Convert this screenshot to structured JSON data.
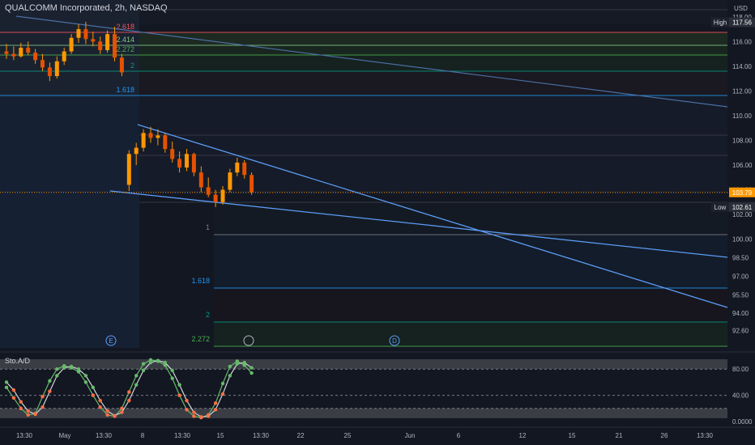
{
  "header": {
    "title": "QUALCOMM Incorporated, 2h, NASDAQ"
  },
  "axis": {
    "currency": "USD",
    "high_label": "High",
    "low_label": "Low"
  },
  "colors": {
    "background": "#131722",
    "up": "#ff9800",
    "down": "#ff9800",
    "trend": "#5b9cf6",
    "grid": "#2a2e39",
    "stoch_k": "#66bb6a",
    "stoch_d": "#ff7043"
  },
  "chart_data": [
    {
      "type": "candlestick",
      "title": "QUALCOMM Incorporated, 2h, NASDAQ",
      "y_ticks": [
        "118.00",
        "116.00",
        "114.00",
        "112.00",
        "110.00",
        "108.00",
        "106.00",
        "104.00",
        "102.00",
        "100.00",
        "98.50",
        "97.00",
        "95.50",
        "94.00",
        "92.60"
      ],
      "y_tick_values": [
        118,
        116,
        114,
        112,
        110,
        108,
        106,
        104,
        102,
        100,
        98.5,
        97,
        95.5,
        94,
        92.6
      ],
      "ylim": [
        91.2,
        119.1
      ],
      "x_ticks": [
        "13:30",
        "May",
        "13:30",
        "8",
        "13:30",
        "15",
        "13:30",
        "22",
        "25",
        "Jun",
        "6",
        "12",
        "15",
        "21",
        "26",
        "13:30"
      ],
      "price_labels": {
        "high": "117.56",
        "current": "103.79",
        "low": "102.61"
      },
      "fib_levels_upper": [
        {
          "label": "2.618",
          "color": "#f7525f"
        },
        {
          "label": "2.414",
          "color": "#81c784"
        },
        {
          "label": "2.272",
          "color": "#4caf50"
        },
        {
          "label": "2",
          "color": "#089981"
        },
        {
          "label": "1.618",
          "color": "#2196f3"
        }
      ],
      "fib_levels_lower": [
        {
          "label": "1",
          "color": "#787b86"
        },
        {
          "label": "1.618",
          "color": "#2196f3"
        },
        {
          "label": "2",
          "color": "#089981"
        },
        {
          "label": "2.272",
          "color": "#4caf50"
        }
      ],
      "events": [
        "E",
        "D"
      ],
      "candles": [
        {
          "o": 115.2,
          "h": 115.8,
          "l": 114.6,
          "c": 115.0
        },
        {
          "o": 115.0,
          "h": 115.6,
          "l": 114.5,
          "c": 114.8
        },
        {
          "o": 114.8,
          "h": 115.9,
          "l": 114.7,
          "c": 115.5
        },
        {
          "o": 115.5,
          "h": 116.0,
          "l": 114.9,
          "c": 115.1
        },
        {
          "o": 115.1,
          "h": 115.4,
          "l": 114.2,
          "c": 114.5
        },
        {
          "o": 114.5,
          "h": 115.0,
          "l": 113.6,
          "c": 113.9
        },
        {
          "o": 113.9,
          "h": 114.3,
          "l": 112.8,
          "c": 113.2
        },
        {
          "o": 113.2,
          "h": 114.8,
          "l": 113.0,
          "c": 114.4
        },
        {
          "o": 114.4,
          "h": 115.5,
          "l": 114.1,
          "c": 115.2
        },
        {
          "o": 115.2,
          "h": 116.6,
          "l": 115.0,
          "c": 116.3
        },
        {
          "o": 116.3,
          "h": 117.4,
          "l": 115.9,
          "c": 117.0
        },
        {
          "o": 117.0,
          "h": 117.6,
          "l": 115.8,
          "c": 116.2
        },
        {
          "o": 116.2,
          "h": 116.8,
          "l": 115.6,
          "c": 116.0
        },
        {
          "o": 116.0,
          "h": 116.4,
          "l": 115.0,
          "c": 115.3
        },
        {
          "o": 115.3,
          "h": 116.9,
          "l": 115.1,
          "c": 116.6
        },
        {
          "o": 116.6,
          "h": 117.2,
          "l": 114.4,
          "c": 114.7
        },
        {
          "o": 114.7,
          "h": 115.0,
          "l": 113.2,
          "c": 113.5
        },
        {
          "o": 104.4,
          "h": 107.2,
          "l": 103.9,
          "c": 106.9
        },
        {
          "o": 106.9,
          "h": 107.8,
          "l": 106.0,
          "c": 107.4
        },
        {
          "o": 107.4,
          "h": 108.9,
          "l": 107.1,
          "c": 108.6
        },
        {
          "o": 108.6,
          "h": 109.1,
          "l": 107.8,
          "c": 108.2
        },
        {
          "o": 108.2,
          "h": 108.9,
          "l": 107.6,
          "c": 108.4
        },
        {
          "o": 108.4,
          "h": 108.6,
          "l": 107.0,
          "c": 107.3
        },
        {
          "o": 107.3,
          "h": 107.9,
          "l": 106.2,
          "c": 106.5
        },
        {
          "o": 106.5,
          "h": 107.1,
          "l": 105.4,
          "c": 105.8
        },
        {
          "o": 105.8,
          "h": 107.3,
          "l": 105.5,
          "c": 106.9
        },
        {
          "o": 106.9,
          "h": 107.0,
          "l": 105.1,
          "c": 105.4
        },
        {
          "o": 105.4,
          "h": 105.9,
          "l": 103.8,
          "c": 104.2
        },
        {
          "o": 104.2,
          "h": 105.0,
          "l": 103.4,
          "c": 103.6
        },
        {
          "o": 103.6,
          "h": 104.0,
          "l": 102.6,
          "c": 103.0
        },
        {
          "o": 103.0,
          "h": 104.3,
          "l": 102.8,
          "c": 104.0
        },
        {
          "o": 104.0,
          "h": 105.7,
          "l": 103.8,
          "c": 105.4
        },
        {
          "o": 105.4,
          "h": 106.6,
          "l": 105.1,
          "c": 106.2
        },
        {
          "o": 106.2,
          "h": 106.4,
          "l": 104.9,
          "c": 105.2
        },
        {
          "o": 105.2,
          "h": 105.4,
          "l": 103.6,
          "c": 103.8
        }
      ]
    },
    {
      "type": "line",
      "title": "Sto.A/D",
      "y_ticks": [
        "80.00",
        "40.00",
        "0.0000"
      ],
      "y_tick_values": [
        80,
        40,
        0
      ],
      "ylim": [
        -5,
        100
      ],
      "series": [
        {
          "name": "",
          "values": [
            52,
            36,
            20,
            10,
            12,
            38,
            62,
            80,
            85,
            82,
            76,
            60,
            40,
            22,
            10,
            8,
            20,
            45,
            70,
            88,
            94,
            92,
            86,
            66,
            40,
            18,
            8,
            6,
            10,
            28,
            58,
            84,
            92,
            86,
            74
          ]
        },
        {
          "name": "",
          "values": [
            60,
            48,
            30,
            16,
            11,
            22,
            46,
            70,
            82,
            84,
            80,
            70,
            52,
            32,
            16,
            9,
            14,
            32,
            56,
            78,
            90,
            93,
            90,
            78,
            56,
            32,
            14,
            7,
            8,
            18,
            42,
            70,
            88,
            90,
            82
          ]
        }
      ]
    }
  ]
}
